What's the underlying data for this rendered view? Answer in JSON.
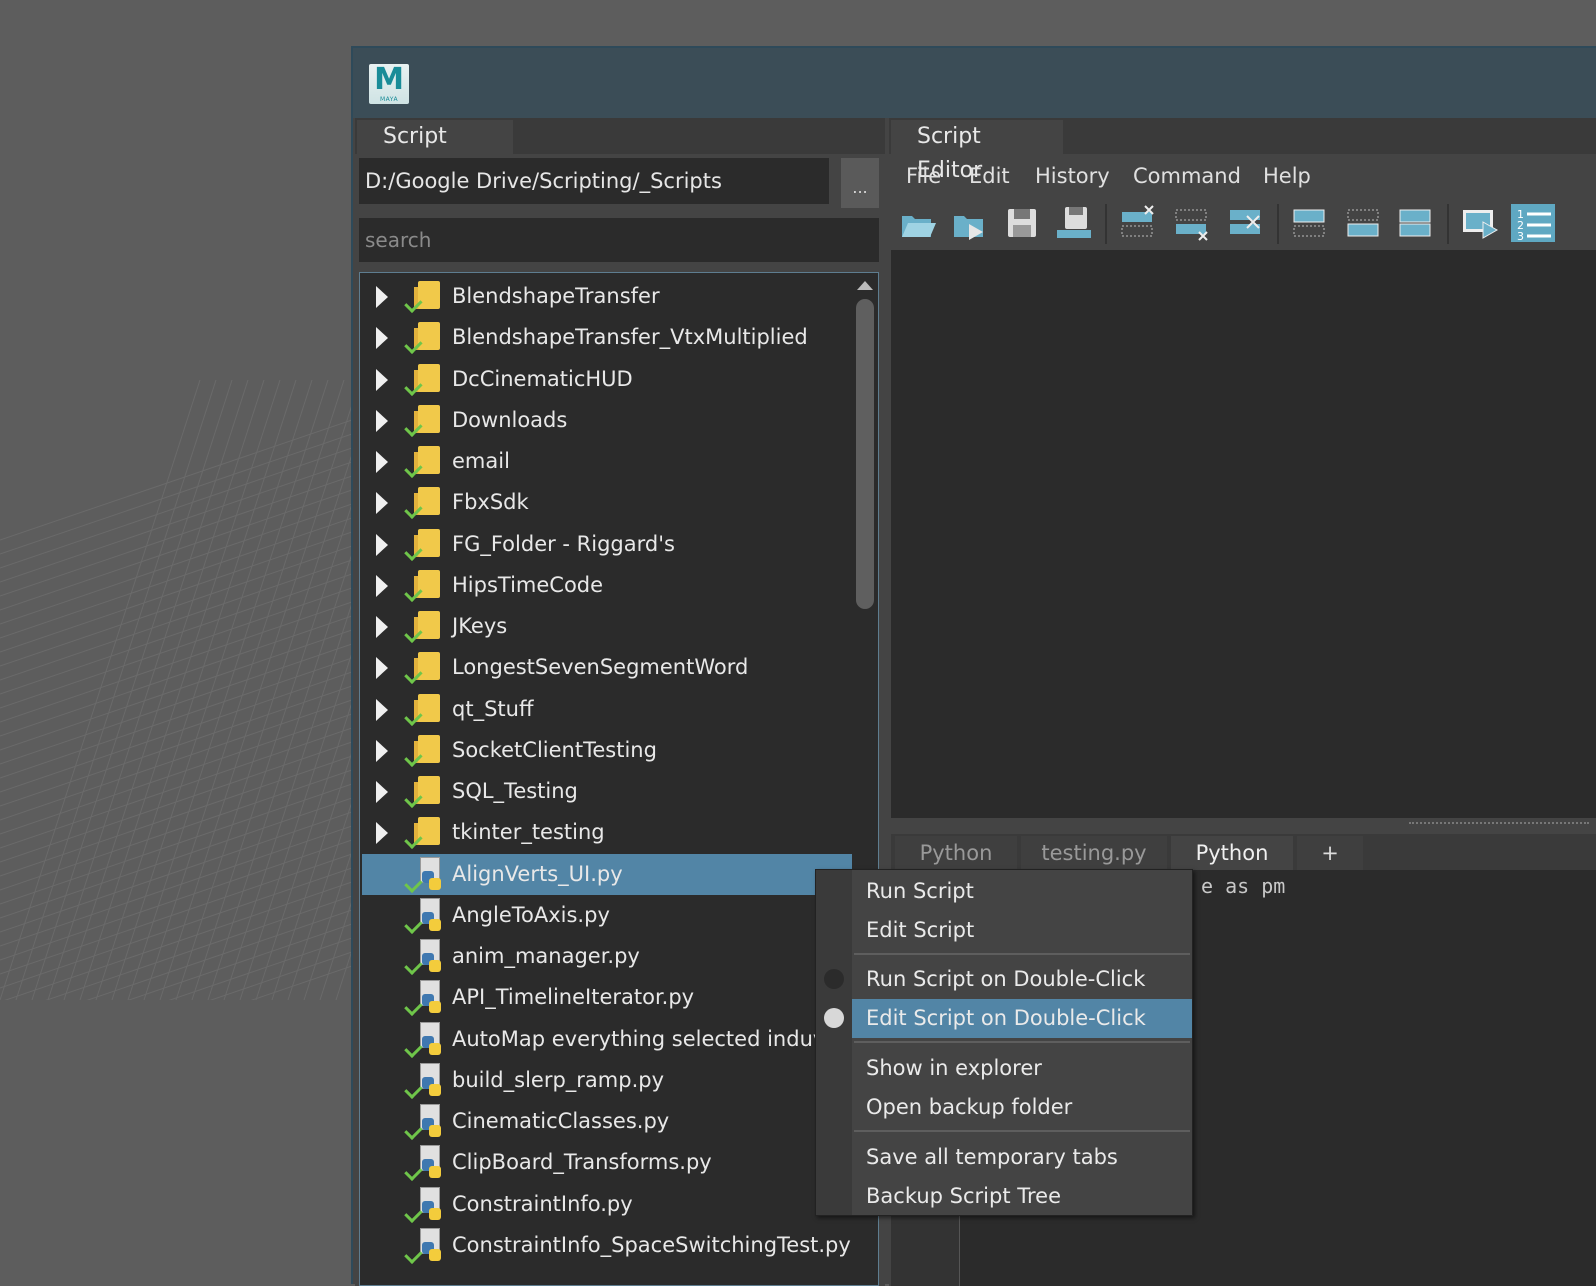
{
  "window": {
    "logo_text": "M",
    "logo_subtext": "MAYA"
  },
  "script_tree": {
    "tab_label": "Script Tree",
    "path": "D:/Google Drive/Scripting/_Scripts",
    "browse_label": "...",
    "search_placeholder": "search",
    "folders": [
      "BlendshapeTransfer",
      "BlendshapeTransfer_VtxMultiplied",
      "DcCinematicHUD",
      "Downloads",
      "email",
      "FbxSdk",
      "FG_Folder - Riggard's",
      "HipsTimeCode",
      "JKeys",
      "LongestSevenSegmentWord",
      "qt_Stuff",
      "SocketClientTesting",
      "SQL_Testing",
      "tkinter_testing"
    ],
    "files": [
      "AlignVerts_UI.py",
      "AngleToAxis.py",
      "anim_manager.py",
      "API_TimelineIterator.py",
      "AutoMap everything selected induvidu",
      "build_slerp_ramp.py",
      "CinematicClasses.py",
      "ClipBoard_Transforms.py",
      "ConstraintInfo.py",
      "ConstraintInfo_SpaceSwitchingTest.py"
    ],
    "selected_file": "AlignVerts_UI.py"
  },
  "script_editor": {
    "tab_label": "Script Editor",
    "menu": [
      "File",
      "Edit",
      "History",
      "Command",
      "Help"
    ],
    "toolbar_icons": [
      "open-script-icon",
      "source-script-icon",
      "save-script-icon",
      "save-to-shelf-icon",
      "clear-history-icon",
      "clear-input-icon",
      "clear-all-icon",
      "show-history-icon",
      "show-input-icon",
      "show-both-icon",
      "execute-icon",
      "line-numbers-icon"
    ],
    "tabs": [
      "Python",
      "testing.py",
      "Python",
      "+"
    ],
    "active_tab_index": 2,
    "code_visible": "e as pm"
  },
  "context_menu": {
    "items": [
      {
        "label": "Run Script"
      },
      {
        "label": "Edit Script"
      },
      {
        "label": "Run Script on Double-Click",
        "radio": "off"
      },
      {
        "label": "Edit Script on Double-Click",
        "radio": "on",
        "highlighted": true
      },
      {
        "label": "Show in explorer"
      },
      {
        "label": "Open backup folder"
      },
      {
        "label": "Save all temporary tabs"
      },
      {
        "label": "Backup Script Tree"
      }
    ]
  }
}
